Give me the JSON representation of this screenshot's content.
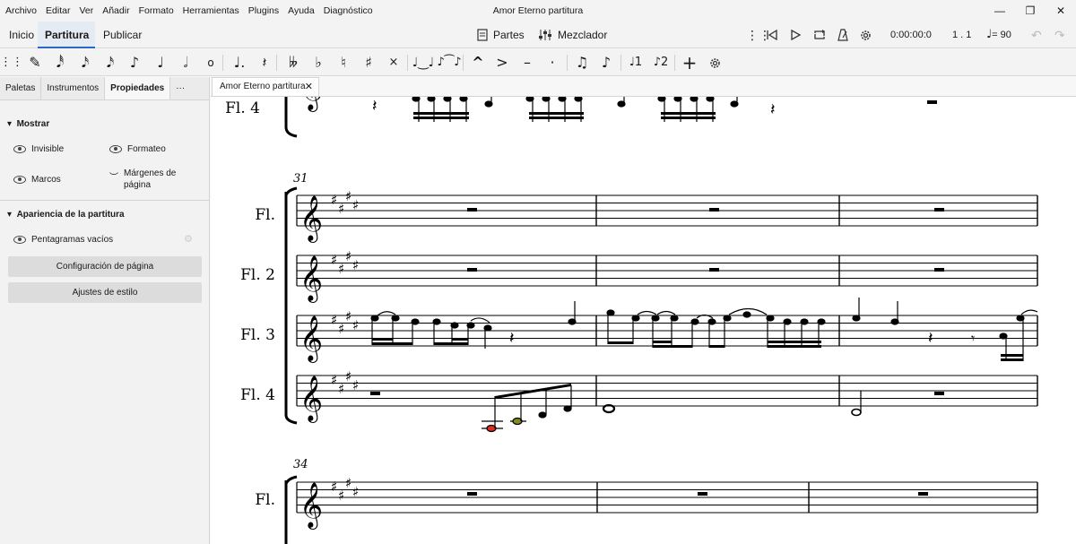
{
  "menu": [
    "Archivo",
    "Editar",
    "Ver",
    "Añadir",
    "Formato",
    "Herramientas",
    "Plugins",
    "Ayuda",
    "Diagnóstico"
  ],
  "window_title": "Amor Eterno partitura",
  "window_controls": {
    "minimize": "—",
    "restore": "❐",
    "close": "✕"
  },
  "workspace_tabs": [
    "Inicio",
    "Partitura",
    "Publicar"
  ],
  "center_buttons": {
    "parts": "Partes",
    "mixer": "Mezclador"
  },
  "playback": {
    "time": "0:00:00:0",
    "position": "1 . 1",
    "tempo": "= 90"
  },
  "note_toolbar": {
    "voice1": "1",
    "voice2": "2"
  },
  "panel": {
    "tabs": [
      "Paletas",
      "Instrumentos",
      "Propiedades"
    ],
    "more": "···",
    "show_section": "Mostrar",
    "show_items": [
      "Invisible",
      "Formateo",
      "Marcos",
      "Márgenes de página"
    ],
    "appearance_section": "Apariencia de la partitura",
    "empty_staves": "Pentagramas vacíos",
    "page_setup_button": "Configuración de página",
    "style_button": "Ajustes de estilo"
  },
  "document_tab": "Amor Eterno partitura",
  "score": {
    "instrument_labels": [
      "Fl. 4",
      "Fl.",
      "Fl. 2",
      "Fl. 3",
      "Fl. 4",
      "Fl."
    ],
    "measure_numbers": [
      "31",
      "34"
    ],
    "clef": "𝄞",
    "key_signature": "♯♯♯♯",
    "rest_glyph": "▬",
    "highlight_colors": {
      "red": "#e02b20",
      "olive": "#8a8a1a"
    }
  }
}
